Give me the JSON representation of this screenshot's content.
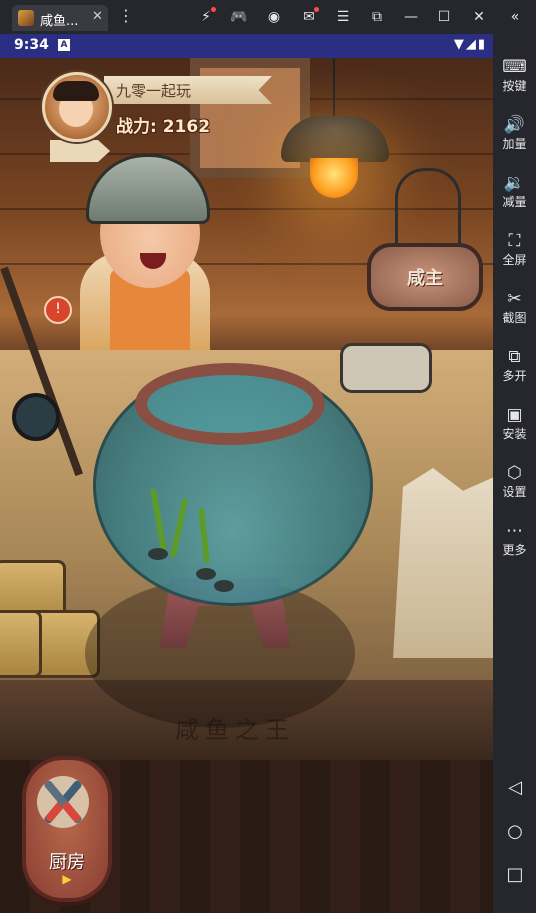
{
  "window": {
    "tab_title": "咸鱼...",
    "tab_close": "✕",
    "menu_glyph": "⋮",
    "toolbar_icons": [
      {
        "name": "boost-icon",
        "glyph": "⚡",
        "has_dot": true
      },
      {
        "name": "gamepad-icon",
        "glyph": "🎮",
        "has_dot": false
      },
      {
        "name": "account-icon",
        "glyph": "◉",
        "has_dot": false
      },
      {
        "name": "mail-icon",
        "glyph": "✉",
        "has_dot": true
      },
      {
        "name": "menu-icon",
        "glyph": "☰",
        "has_dot": false
      },
      {
        "name": "resize-window-icon",
        "glyph": "⧉",
        "has_dot": false
      },
      {
        "name": "minimize-icon",
        "glyph": "—",
        "has_dot": false
      },
      {
        "name": "maximize-icon",
        "glyph": "☐",
        "has_dot": false
      },
      {
        "name": "close-window-icon",
        "glyph": "✕",
        "has_dot": false
      },
      {
        "name": "collapse-sidebar-icon",
        "glyph": "«",
        "has_dot": false
      }
    ]
  },
  "status_bar": {
    "time": "9:34",
    "a_badge": "A",
    "icons": "▼◢▮",
    "background": "#2b2f84"
  },
  "game": {
    "player_name": "九零一起玩",
    "power": "战力: 2162",
    "sign_text": "咸主",
    "engraving": "咸鱼之王",
    "badge_glyph": "!",
    "kitchen": {
      "label": "厨房",
      "play_glyph": "▶"
    }
  },
  "sidebar": {
    "items": [
      {
        "icon": "keyboard-icon",
        "glyph": "⌨",
        "label": "按键"
      },
      {
        "icon": "volume-up-icon",
        "glyph": "🔊",
        "label": "加量"
      },
      {
        "icon": "volume-down-icon",
        "glyph": "🔉",
        "label": "减量"
      },
      {
        "icon": "fullscreen-icon",
        "glyph": "⛶",
        "label": "全屏"
      },
      {
        "icon": "scissors-icon",
        "glyph": "✂",
        "label": "截图"
      },
      {
        "icon": "multi-instance-icon",
        "glyph": "⧉",
        "label": "多开"
      },
      {
        "icon": "apk-icon",
        "glyph": "▣",
        "label": "安装"
      },
      {
        "icon": "settings-icon",
        "glyph": "⬡",
        "label": "设置"
      },
      {
        "icon": "more-icon",
        "glyph": "⋯",
        "label": "更多"
      }
    ],
    "nav": {
      "back": "◁",
      "home": "○",
      "recents": "□"
    }
  }
}
